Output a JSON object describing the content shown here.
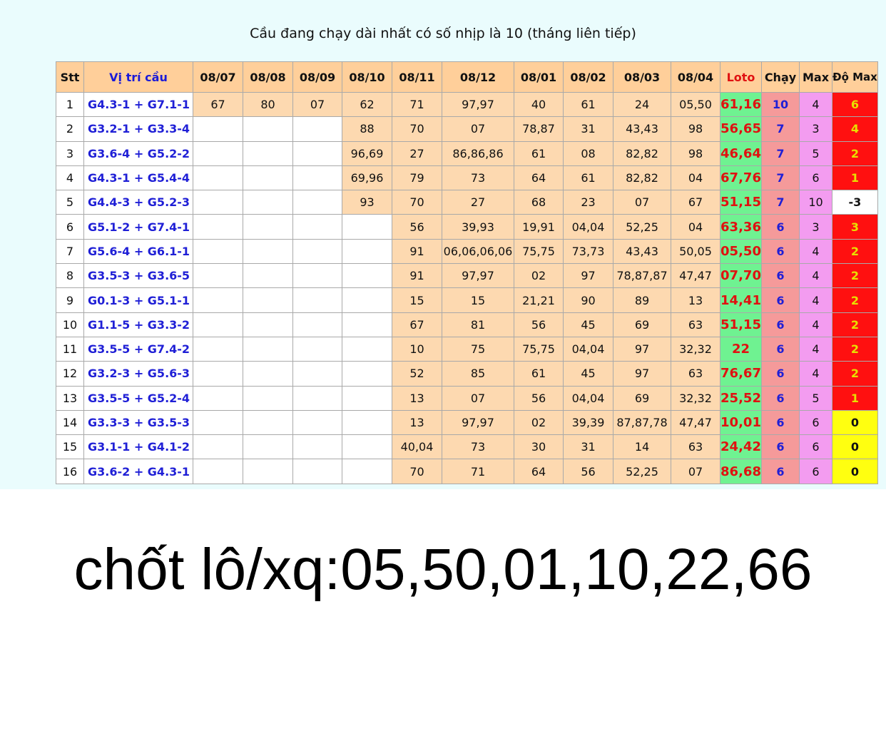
{
  "title": "Cầu đang chạy dài nhất có số nhịp là 10 (tháng liên tiếp)",
  "headers": [
    "Stt",
    "Vị trí cầu",
    "08/07",
    "08/08",
    "08/09",
    "08/10",
    "08/11",
    "08/12",
    "08/01",
    "08/02",
    "08/03",
    "08/04",
    "Loto",
    "Chạy",
    "Max",
    "Độ Max"
  ],
  "colors": {
    "panel_bg": "#eafcfd",
    "header_bg": "#ffcf9a",
    "cell_filled": "#fdd9b0",
    "loto_bg": "#6ff291",
    "chay_bg": "#f59a9a",
    "max_bg": "#f39cf0",
    "do_red": "#ff1010",
    "do_yellow": "#ffff10",
    "blue_text": "#1f1fd6",
    "red_text": "#e01111"
  },
  "rows": [
    {
      "stt": "1",
      "pos": "G4.3-1 + G7.1-1",
      "vals": [
        "67",
        "80",
        "07",
        "62",
        "71",
        "97,97",
        "40",
        "61",
        "24",
        "05,50"
      ],
      "loto": "61,16",
      "chay": "10",
      "max": "4",
      "do": "6",
      "do_color": "red"
    },
    {
      "stt": "2",
      "pos": "G3.2-1 + G3.3-4",
      "vals": [
        "",
        "",
        "",
        "88",
        "70",
        "07",
        "78,87",
        "31",
        "43,43",
        "98"
      ],
      "loto": "56,65",
      "chay": "7",
      "max": "3",
      "do": "4",
      "do_color": "red"
    },
    {
      "stt": "3",
      "pos": "G3.6-4 + G5.2-2",
      "vals": [
        "",
        "",
        "",
        "96,69",
        "27",
        "86,86,86",
        "61",
        "08",
        "82,82",
        "98"
      ],
      "loto": "46,64",
      "chay": "7",
      "max": "5",
      "do": "2",
      "do_color": "red"
    },
    {
      "stt": "4",
      "pos": "G4.3-1 + G5.4-4",
      "vals": [
        "",
        "",
        "",
        "69,96",
        "79",
        "73",
        "64",
        "61",
        "82,82",
        "04"
      ],
      "loto": "67,76",
      "chay": "7",
      "max": "6",
      "do": "1",
      "do_color": "red"
    },
    {
      "stt": "5",
      "pos": "G4.4-3 + G5.2-3",
      "vals": [
        "",
        "",
        "",
        "93",
        "70",
        "27",
        "68",
        "23",
        "07",
        "67"
      ],
      "loto": "51,15",
      "chay": "7",
      "max": "10",
      "do": "-3",
      "do_color": "white"
    },
    {
      "stt": "6",
      "pos": "G5.1-2 + G7.4-1",
      "vals": [
        "",
        "",
        "",
        "",
        "56",
        "39,93",
        "19,91",
        "04,04",
        "52,25",
        "04"
      ],
      "loto": "63,36",
      "chay": "6",
      "max": "3",
      "do": "3",
      "do_color": "red"
    },
    {
      "stt": "7",
      "pos": "G5.6-4 + G6.1-1",
      "vals": [
        "",
        "",
        "",
        "",
        "91",
        "06,06,06,06",
        "75,75",
        "73,73",
        "43,43",
        "50,05"
      ],
      "loto": "05,50",
      "chay": "6",
      "max": "4",
      "do": "2",
      "do_color": "red"
    },
    {
      "stt": "8",
      "pos": "G3.5-3 + G3.6-5",
      "vals": [
        "",
        "",
        "",
        "",
        "91",
        "97,97",
        "02",
        "97",
        "78,87,87",
        "47,47"
      ],
      "loto": "07,70",
      "chay": "6",
      "max": "4",
      "do": "2",
      "do_color": "red"
    },
    {
      "stt": "9",
      "pos": "G0.1-3 + G5.1-1",
      "vals": [
        "",
        "",
        "",
        "",
        "15",
        "15",
        "21,21",
        "90",
        "89",
        "13"
      ],
      "loto": "14,41",
      "chay": "6",
      "max": "4",
      "do": "2",
      "do_color": "red"
    },
    {
      "stt": "10",
      "pos": "G1.1-5 + G3.3-2",
      "vals": [
        "",
        "",
        "",
        "",
        "67",
        "81",
        "56",
        "45",
        "69",
        "63"
      ],
      "loto": "51,15",
      "chay": "6",
      "max": "4",
      "do": "2",
      "do_color": "red"
    },
    {
      "stt": "11",
      "pos": "G3.5-5 + G7.4-2",
      "vals": [
        "",
        "",
        "",
        "",
        "10",
        "75",
        "75,75",
        "04,04",
        "97",
        "32,32"
      ],
      "loto": "22",
      "chay": "6",
      "max": "4",
      "do": "2",
      "do_color": "red"
    },
    {
      "stt": "12",
      "pos": "G3.2-3 + G5.6-3",
      "vals": [
        "",
        "",
        "",
        "",
        "52",
        "85",
        "61",
        "45",
        "97",
        "63"
      ],
      "loto": "76,67",
      "chay": "6",
      "max": "4",
      "do": "2",
      "do_color": "red"
    },
    {
      "stt": "13",
      "pos": "G3.5-5 + G5.2-4",
      "vals": [
        "",
        "",
        "",
        "",
        "13",
        "07",
        "56",
        "04,04",
        "69",
        "32,32"
      ],
      "loto": "25,52",
      "chay": "6",
      "max": "5",
      "do": "1",
      "do_color": "red"
    },
    {
      "stt": "14",
      "pos": "G3.3-3 + G3.5-3",
      "vals": [
        "",
        "",
        "",
        "",
        "13",
        "97,97",
        "02",
        "39,39",
        "87,87,78",
        "47,47"
      ],
      "loto": "10,01",
      "chay": "6",
      "max": "6",
      "do": "0",
      "do_color": "yellow"
    },
    {
      "stt": "15",
      "pos": "G3.1-1 + G4.1-2",
      "vals": [
        "",
        "",
        "",
        "",
        "40,04",
        "73",
        "30",
        "31",
        "14",
        "63"
      ],
      "loto": "24,42",
      "chay": "6",
      "max": "6",
      "do": "0",
      "do_color": "yellow"
    },
    {
      "stt": "16",
      "pos": "G3.6-2 + G4.3-1",
      "vals": [
        "",
        "",
        "",
        "",
        "70",
        "71",
        "64",
        "56",
        "52,25",
        "07"
      ],
      "loto": "86,68",
      "chay": "6",
      "max": "6",
      "do": "0",
      "do_color": "yellow"
    }
  ],
  "footer": "chốt lô/xq:05,50,01,10,22,66"
}
